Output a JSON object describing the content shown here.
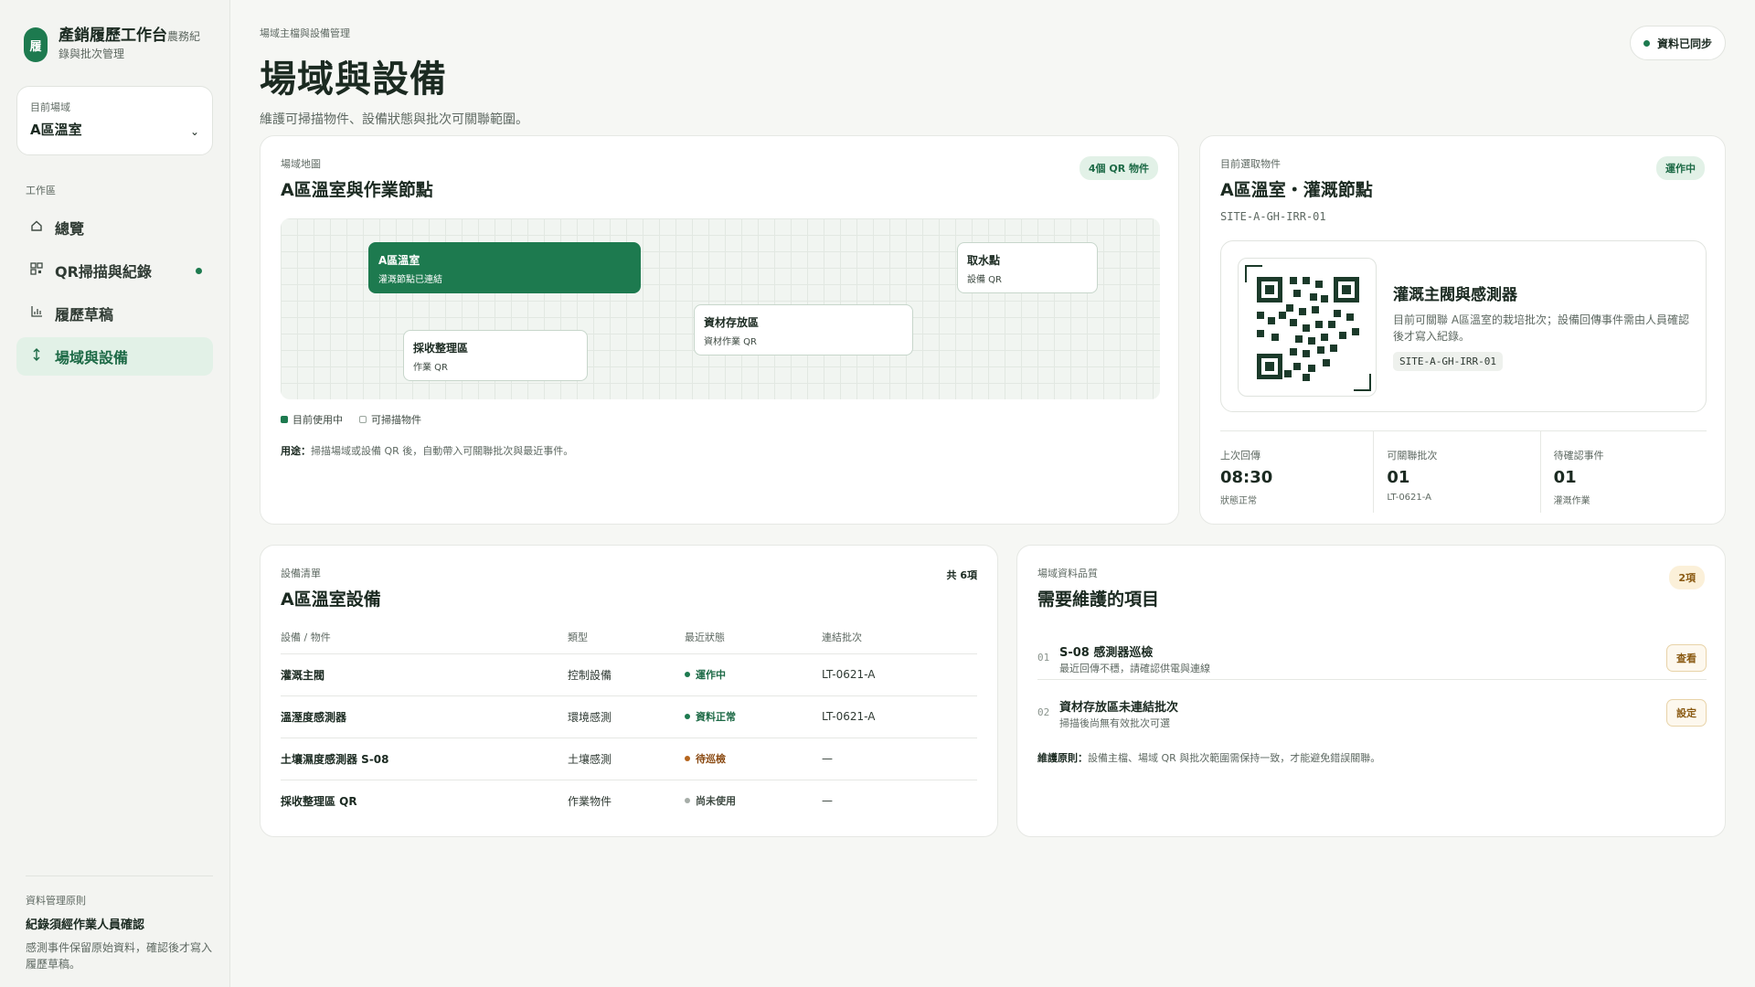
{
  "sidebar": {
    "brand": {
      "logo": "履",
      "title": "產銷履歷工作台",
      "subtitle_inline": "農務紀",
      "subtitle": "錄與批次管理"
    },
    "site_select": {
      "label": "目前場域",
      "value": "A區溫室"
    },
    "nav_title": "工作區",
    "items": [
      {
        "label": "總覽",
        "icon": "home-icon"
      },
      {
        "label": "QR掃描與紀錄",
        "icon": "qr-icon"
      },
      {
        "label": "履歷草稿",
        "icon": "chart-icon"
      },
      {
        "label": "場域與設備",
        "icon": "swap-icon"
      }
    ],
    "footer": {
      "kicker": "資料管理原則",
      "title": "紀錄須經作業人員確認",
      "desc": "感測事件保留原始資料，確認後才寫入履歷草稿。"
    }
  },
  "header": {
    "breadcrumb": "場域主檔與設備管理",
    "title": "場域與設備",
    "desc": "維護可掃描物件、設備狀態與批次可關聯範圍。",
    "sync": "資料已同步"
  },
  "map": {
    "kicker": "場域地圖",
    "title": "A區溫室與作業節點",
    "badge": "4個 QR 物件",
    "nodes": [
      {
        "title": "A區溫室",
        "sub": "灌溉節點已連結"
      },
      {
        "title": "取水點",
        "sub": "設備 QR"
      },
      {
        "title": "資材存放區",
        "sub": "資材作業 QR"
      },
      {
        "title": "採收整理區",
        "sub": "作業 QR"
      }
    ],
    "legend_active": "目前使用中",
    "legend_scannable": "可掃描物件",
    "usage_label": "用途：",
    "usage_text": "掃描場域或設備 QR 後，自動帶入可關聯批次與最近事件。"
  },
  "object": {
    "kicker": "目前選取物件",
    "title": "A區溫室・灌溉節點",
    "code": "SITE-A-GH-IRR-01",
    "badge": "運作中",
    "qr_title": "灌溉主閥與感測器",
    "qr_desc": "目前可關聯 A區溫室的栽培批次；設備回傳事件需由人員確認後才寫入紀錄。",
    "qr_code": "SITE-A-GH-IRR-01",
    "stats": [
      {
        "label": "上次回傳",
        "value": "08:30",
        "note": "狀態正常"
      },
      {
        "label": "可關聯批次",
        "value": "01",
        "note": "LT-0621-A"
      },
      {
        "label": "待確認事件",
        "value": "01",
        "note": "灌溉作業"
      }
    ]
  },
  "equipment": {
    "kicker": "設備清單",
    "title": "A區溫室設備",
    "count": "共 6項",
    "headers": [
      "設備 / 物件",
      "類型",
      "最近狀態",
      "連結批次"
    ],
    "rows": [
      {
        "name": "灌溉主閥",
        "type": "控制設備",
        "status": "運作中",
        "status_color": "#1d7a4f",
        "batch": "LT-0621-A"
      },
      {
        "name": "溫溼度感測器",
        "type": "環境感測",
        "status": "資料正常",
        "status_color": "#1d7a4f",
        "batch": "LT-0621-A"
      },
      {
        "name": "土壤濕度感測器 S-08",
        "type": "土壤感測",
        "status": "待巡檢",
        "status_color": "#b5651d",
        "batch": "—"
      },
      {
        "name": "採收整理區 QR",
        "type": "作業物件",
        "status": "尚未使用",
        "status_color": "#a6ada8",
        "batch": "—"
      }
    ]
  },
  "quality": {
    "kicker": "場域資料品質",
    "title": "需要維護的項目",
    "badge": "2項",
    "items": [
      {
        "num": "01",
        "title": "S-08 感測器巡檢",
        "desc": "最近回傳不穩，請確認供電與連線",
        "action": "查看"
      },
      {
        "num": "02",
        "title": "資材存放區未連結批次",
        "desc": "掃描後尚無有效批次可選",
        "action": "設定"
      }
    ],
    "note_label": "維護原則：",
    "note_text": "設備主檔、場域 QR 與批次範圍需保持一致，才能避免錯誤關聯。"
  },
  "colors": {
    "accent": "#1d7a4f",
    "accent_soft": "#e2f1e7",
    "warn": "#8a5a12"
  }
}
